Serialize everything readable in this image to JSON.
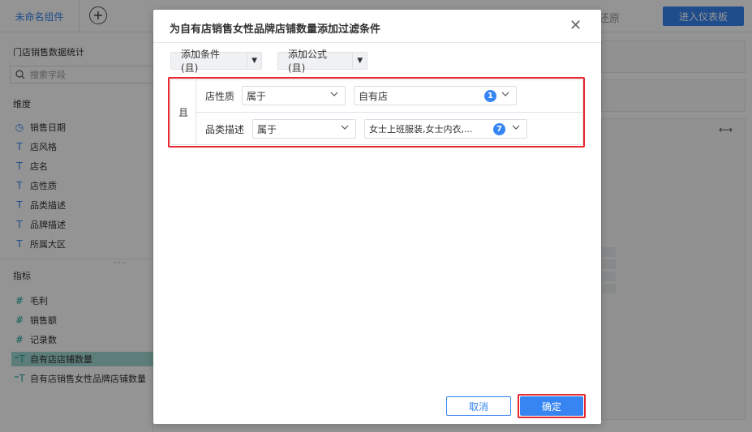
{
  "topbar": {
    "tab_label": "未命名组件",
    "add_tab": "+",
    "restore_label": "还原",
    "enter_dashboard": "进入仪表板"
  },
  "left_panel": {
    "package_name": "门店销售数据统计",
    "search_placeholder": "搜索字段",
    "dimension_title": "维度",
    "dimensions": [
      {
        "icon": "clock-icon",
        "symbol": "◷",
        "label": "销售日期"
      },
      {
        "icon": "text-type-icon",
        "symbol": "T",
        "label": "店风格"
      },
      {
        "icon": "text-type-icon",
        "symbol": "T",
        "label": "店名"
      },
      {
        "icon": "text-type-icon",
        "symbol": "T",
        "label": "店性质"
      },
      {
        "icon": "text-type-icon",
        "symbol": "T",
        "label": "品类描述"
      },
      {
        "icon": "text-type-icon",
        "symbol": "T",
        "label": "品牌描述"
      },
      {
        "icon": "text-type-icon",
        "symbol": "T",
        "label": "所属大区"
      }
    ],
    "measure_title": "指标",
    "measures": [
      {
        "icon": "number-type-icon",
        "symbol": "#",
        "label": "毛利",
        "highlighted": false
      },
      {
        "icon": "number-type-icon",
        "symbol": "#",
        "label": "销售额",
        "highlighted": false
      },
      {
        "icon": "record-count-icon",
        "symbol": "#",
        "label": "记录数",
        "highlighted": false
      },
      {
        "icon": "calc-text-icon",
        "symbol": "⁼T",
        "label": "自有店店铺数量",
        "highlighted": true
      },
      {
        "icon": "calc-text-icon",
        "symbol": "⁼T",
        "label": "自有店销售女性品牌店铺数量",
        "highlighted": false
      }
    ]
  },
  "dialog": {
    "title": "为自有店销售女性品牌店铺数量添加过滤条件",
    "close_symbol": "✕",
    "add_condition_label": "添加条件(且)",
    "add_formula_label": "添加公式(且)",
    "dropdown_symbol": "▼",
    "and_label": "且",
    "conditions": [
      {
        "field": "店性质",
        "operator": "属于",
        "value": "自有店",
        "count": "1"
      },
      {
        "field": "品类描述",
        "operator": "属于",
        "value": "女士上班服装,女士内衣,...",
        "count": "7"
      }
    ],
    "cancel_label": "取消",
    "ok_label": "确定"
  },
  "colors": {
    "accent": "#3685f2",
    "highlight_red": "#e8262e",
    "teal_icon": "#1ea79e",
    "highlight_row": "#9fd7d0"
  }
}
